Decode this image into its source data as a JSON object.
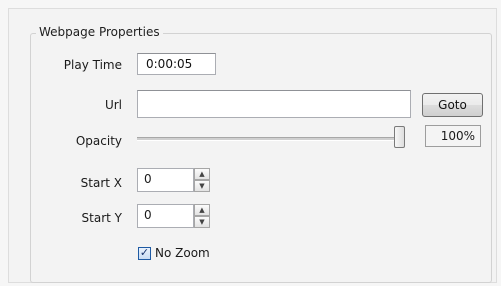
{
  "group": {
    "title": "Webpage Properties"
  },
  "play_time": {
    "label": "Play Time",
    "value": "0:00:05"
  },
  "url": {
    "label": "Url",
    "value": "",
    "button_label": "Goto"
  },
  "opacity": {
    "label": "Opacity",
    "value_text": "100%",
    "level": 1.0
  },
  "start_x": {
    "label": "Start X",
    "value": "0"
  },
  "start_y": {
    "label": "Start Y",
    "value": "0"
  },
  "no_zoom": {
    "label": "No Zoom",
    "checked": true
  },
  "colors": {
    "checkbox_border": "#1e5aa3",
    "checkmark": "#17326c"
  },
  "icons": {
    "spin_up": "▲",
    "spin_down": "▼",
    "check": "✓"
  }
}
